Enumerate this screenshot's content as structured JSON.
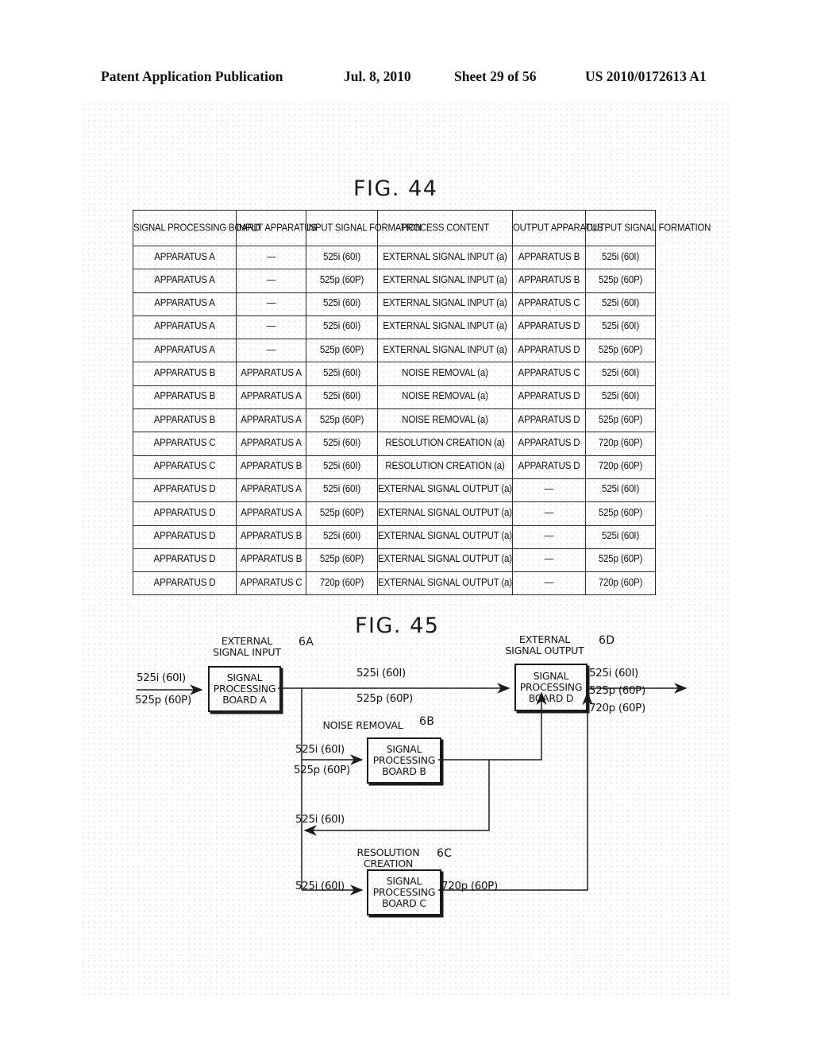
{
  "header": {
    "publication": "Patent Application Publication",
    "date": "Jul. 8, 2010",
    "sheet": "Sheet 29 of 56",
    "number": "US 2010/0172613 A1"
  },
  "fig44": {
    "title": "FIG. 44",
    "columns": [
      "SIGNAL PROCESSING BOARD",
      "INPUT APPARATUS",
      "INPUT SIGNAL FORMATION",
      "PROCESS CONTENT",
      "OUTPUT APPARATUS",
      "OUTPUT SIGNAL FORMATION"
    ],
    "columns_lines": [
      [
        "SIGNAL PROCESSING",
        "BOARD"
      ],
      [
        "INPUT",
        "APPARATUS"
      ],
      [
        "INPUT SIGNAL",
        "FORMATION"
      ],
      [
        "PROCESS CONTENT"
      ],
      [
        "OUTPUT",
        "APPARATUS"
      ],
      [
        "OUTPUT SIGNAL",
        "FORMATION"
      ]
    ],
    "rows": [
      [
        "APPARATUS A",
        "—",
        "525i (60I)",
        "EXTERNAL SIGNAL INPUT (a)",
        "APPARATUS B",
        "525i (60I)"
      ],
      [
        "APPARATUS A",
        "—",
        "525p (60P)",
        "EXTERNAL SIGNAL INPUT (a)",
        "APPARATUS B",
        "525p (60P)"
      ],
      [
        "APPARATUS A",
        "—",
        "525i (60I)",
        "EXTERNAL SIGNAL INPUT (a)",
        "APPARATUS C",
        "525i (60I)"
      ],
      [
        "APPARATUS A",
        "—",
        "525i (60I)",
        "EXTERNAL SIGNAL INPUT (a)",
        "APPARATUS D",
        "525i (60I)"
      ],
      [
        "APPARATUS A",
        "—",
        "525p (60P)",
        "EXTERNAL SIGNAL INPUT (a)",
        "APPARATUS D",
        "525p (60P)"
      ],
      [
        "APPARATUS B",
        "APPARATUS A",
        "525i (60I)",
        "NOISE REMOVAL (a)",
        "APPARATUS C",
        "525i (60I)"
      ],
      [
        "APPARATUS B",
        "APPARATUS A",
        "525i (60I)",
        "NOISE REMOVAL (a)",
        "APPARATUS D",
        "525i (60I)"
      ],
      [
        "APPARATUS B",
        "APPARATUS A",
        "525p (60P)",
        "NOISE REMOVAL (a)",
        "APPARATUS D",
        "525p (60P)"
      ],
      [
        "APPARATUS C",
        "APPARATUS A",
        "525i (60I)",
        "RESOLUTION CREATION (a)",
        "APPARATUS D",
        "720p (60P)"
      ],
      [
        "APPARATUS C",
        "APPARATUS B",
        "525i (60I)",
        "RESOLUTION CREATION (a)",
        "APPARATUS D",
        "720p (60P)"
      ],
      [
        "APPARATUS D",
        "APPARATUS A",
        "525i (60I)",
        "EXTERNAL SIGNAL OUTPUT (a)",
        "—",
        "525i (60I)"
      ],
      [
        "APPARATUS D",
        "APPARATUS A",
        "525p (60P)",
        "EXTERNAL SIGNAL OUTPUT (a)",
        "—",
        "525p (60P)"
      ],
      [
        "APPARATUS D",
        "APPARATUS B",
        "525i (60I)",
        "EXTERNAL SIGNAL OUTPUT (a)",
        "—",
        "525i (60I)"
      ],
      [
        "APPARATUS D",
        "APPARATUS B",
        "525p (60P)",
        "EXTERNAL SIGNAL OUTPUT (a)",
        "—",
        "525p (60P)"
      ],
      [
        "APPARATUS D",
        "APPARATUS C",
        "720p (60P)",
        "EXTERNAL SIGNAL OUTPUT (a)",
        "—",
        "720p (60P)"
      ]
    ]
  },
  "fig45": {
    "title": "FIG. 45",
    "boards": {
      "a": {
        "ref": "6A",
        "caption_line1": "EXTERNAL",
        "caption_line2": "SIGNAL INPUT",
        "box_line1": "SIGNAL",
        "box_line2": "PROCESSING",
        "box_line3": "BOARD A",
        "input1": "525i (60I)",
        "input2": "525p (60P)"
      },
      "b": {
        "ref": "6B",
        "caption_line1": "NOISE REMOVAL",
        "box_line1": "SIGNAL",
        "box_line2": "PROCESSING",
        "box_line3": "BOARD B",
        "input1": "525i (60I)",
        "input2": "525p (60P)"
      },
      "c": {
        "ref": "6C",
        "caption_line1": "RESOLUTION",
        "caption_line2": "CREATION",
        "box_line1": "SIGNAL",
        "box_line2": "PROCESSING",
        "box_line3": "BOARD C",
        "input1": "525i (60I)",
        "output1": "720p (60P)"
      },
      "d": {
        "ref": "6D",
        "caption_line1": "EXTERNAL",
        "caption_line2": "SIGNAL OUTPUT",
        "box_line1": "SIGNAL",
        "box_line2": "PROCESSING",
        "box_line3": "BOARD D",
        "output1": "525i (60I)",
        "output2": "525p (60P)",
        "output3": "720p (60P)"
      }
    },
    "bus_labels": {
      "a_to_d_1": "525i (60I)",
      "a_to_d_2": "525p (60P)",
      "b_feedback": "525i (60I)"
    }
  }
}
